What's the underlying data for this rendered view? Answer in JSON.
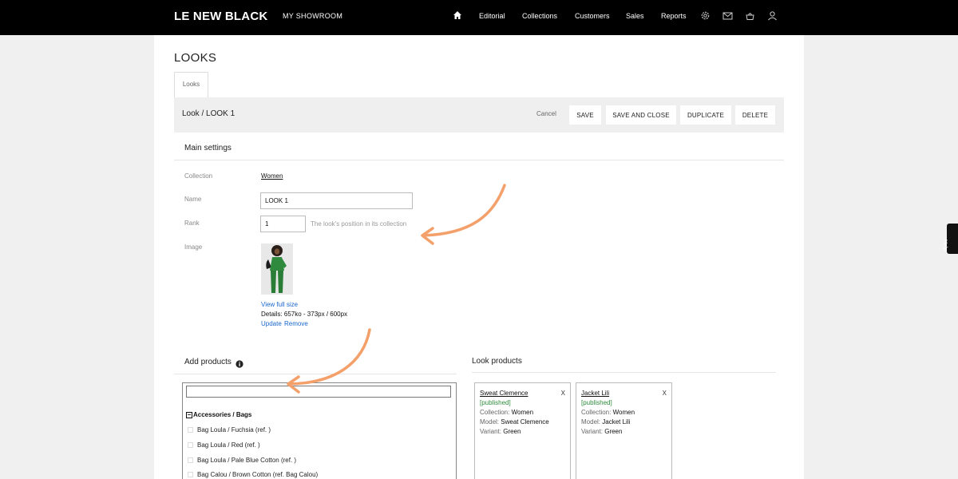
{
  "brand": {
    "logo": "LE NEW BLACK",
    "showroom": "MY SHOWROOM"
  },
  "nav": {
    "items": [
      "Editorial",
      "Collections",
      "Customers",
      "Sales",
      "Reports"
    ],
    "icons": [
      "home-icon",
      "gear-icon",
      "mail-icon",
      "basket-icon",
      "user-icon"
    ]
  },
  "page": {
    "title": "LOOKS",
    "tab": "Looks"
  },
  "toolbar": {
    "title": "Look / LOOK 1",
    "cancel": "Cancel",
    "save": "SAVE",
    "save_close": "SAVE AND CLOSE",
    "duplicate": "DUPLICATE",
    "delete": "DELETE"
  },
  "main": {
    "title": "Main settings",
    "collection_label": "Collection",
    "collection_value": "Women",
    "name_label": "Name",
    "name_value": "LOOK 1",
    "rank_label": "Rank",
    "rank_value": "1",
    "rank_help": "The look's position in its collection",
    "image_label": "Image",
    "view_full": "View full size",
    "details": "Details: 657ko - 373px / 600px",
    "update": "Update",
    "remove": "Remove"
  },
  "add_products": {
    "title": "Add products",
    "search_value": "",
    "group": "Accessories / Bags",
    "items": [
      "Bag Loula / Fuchsia (ref. )",
      "Bag Loula / Red (ref. )",
      "Bag Loula / Pale Blue Cotton (ref. )",
      "Bag Calou / Brown Cotton (ref. Bag Calou)"
    ]
  },
  "look_products": {
    "title": "Look products",
    "close": "X",
    "collection_key": "Collection:",
    "model_key": "Model:",
    "variant_key": "Variant:",
    "cards": [
      {
        "name": "Sweat Clemence",
        "status": "[published]",
        "collection": "Women",
        "model": "Sweat Clemence",
        "variant": "Green"
      },
      {
        "name": "Jacket Lili",
        "status": "[published]",
        "collection": "Women",
        "model": "Jacket Lili",
        "variant": "Green"
      }
    ]
  },
  "help": {
    "label": "Help"
  },
  "colors": {
    "topbar": "#000000",
    "link": "#1a66cc",
    "published": "#2e8b3c",
    "arrow": "#f4a06a"
  }
}
